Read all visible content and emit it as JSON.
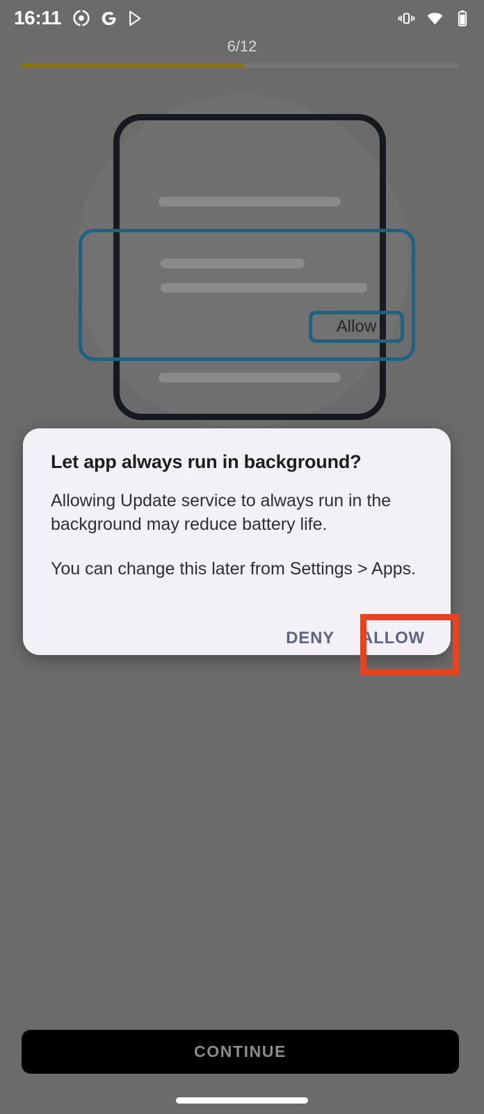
{
  "status_bar": {
    "clock": "16:11",
    "left_icons": [
      "record-target-icon",
      "google-g-icon",
      "play-store-icon"
    ],
    "right_icons": [
      "vibrate-icon",
      "wifi-icon",
      "battery-icon"
    ]
  },
  "progress": {
    "label": "6/12",
    "current": 6,
    "total": 12,
    "percent": 50,
    "fill_color": "#8a7414",
    "track_color": "#767676"
  },
  "illustration": {
    "name": "permission-prompt-illustration",
    "accent_color": "#1d6380",
    "frame_color": "#16191d",
    "allow_pill_label": "Allow"
  },
  "dialog": {
    "title": "Let app always run in background?",
    "body_1": "Allowing Update service to always run in the background may reduce battery life.",
    "body_2": "You can change this later from Settings > Apps.",
    "deny_label": "DENY",
    "allow_label": "ALLOW",
    "button_text_color": "#5b6486",
    "surface_color": "#f3f1f6"
  },
  "highlight": {
    "target": "allow-button",
    "color": "#e8421f"
  },
  "footer": {
    "continue_label": "CONTINUE",
    "continue_bg": "#000000",
    "continue_text_color": "#8c8c8c"
  },
  "screen": {
    "scrim_color": "#6b6b6b"
  }
}
